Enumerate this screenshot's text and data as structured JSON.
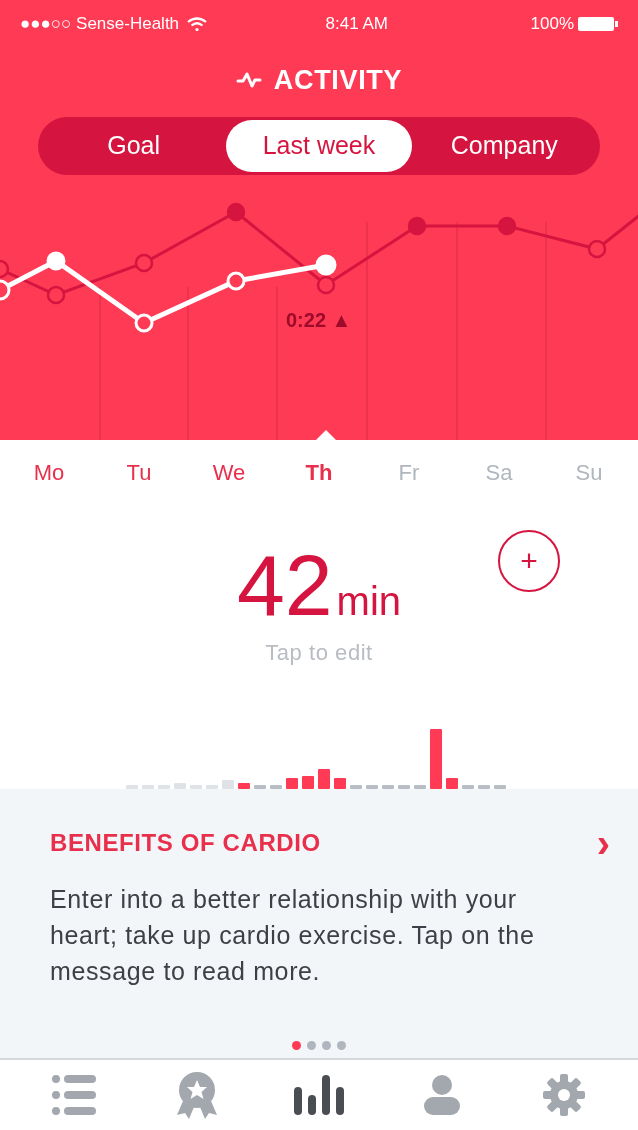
{
  "status_bar": {
    "carrier": "●●●○○ Sense-Health",
    "time": "8:41 AM",
    "battery": "100%"
  },
  "title": "ACTIVITY",
  "tabs": [
    {
      "label": "Goal",
      "selected": false
    },
    {
      "label": "Last week",
      "selected": true
    },
    {
      "label": "Company",
      "selected": false
    }
  ],
  "chart_label": "0:22 ▲",
  "days": [
    {
      "label": "Mo",
      "selected": false,
      "future": false
    },
    {
      "label": "Tu",
      "selected": false,
      "future": false
    },
    {
      "label": "We",
      "selected": false,
      "future": false
    },
    {
      "label": "Th",
      "selected": true,
      "future": false
    },
    {
      "label": "Fr",
      "selected": false,
      "future": true
    },
    {
      "label": "Sa",
      "selected": false,
      "future": true
    },
    {
      "label": "Su",
      "selected": false,
      "future": true
    }
  ],
  "summary": {
    "value": "42",
    "unit": "min",
    "hint": "Tap to edit",
    "add": "+"
  },
  "card": {
    "title": "BENEFITS OF CARDIO",
    "chevron": "›",
    "text": "Enter into a better relationship with your heart; take up cardio exercise. Tap on the message to read more."
  },
  "pages": [
    {
      "selected": true
    },
    {
      "selected": false
    },
    {
      "selected": false
    },
    {
      "selected": false
    }
  ],
  "nav": [
    {
      "kind": "list",
      "selected": false
    },
    {
      "kind": "award",
      "selected": false
    },
    {
      "kind": "stats",
      "selected": true
    },
    {
      "kind": "profile",
      "selected": false
    },
    {
      "kind": "settings",
      "selected": false
    }
  ]
}
